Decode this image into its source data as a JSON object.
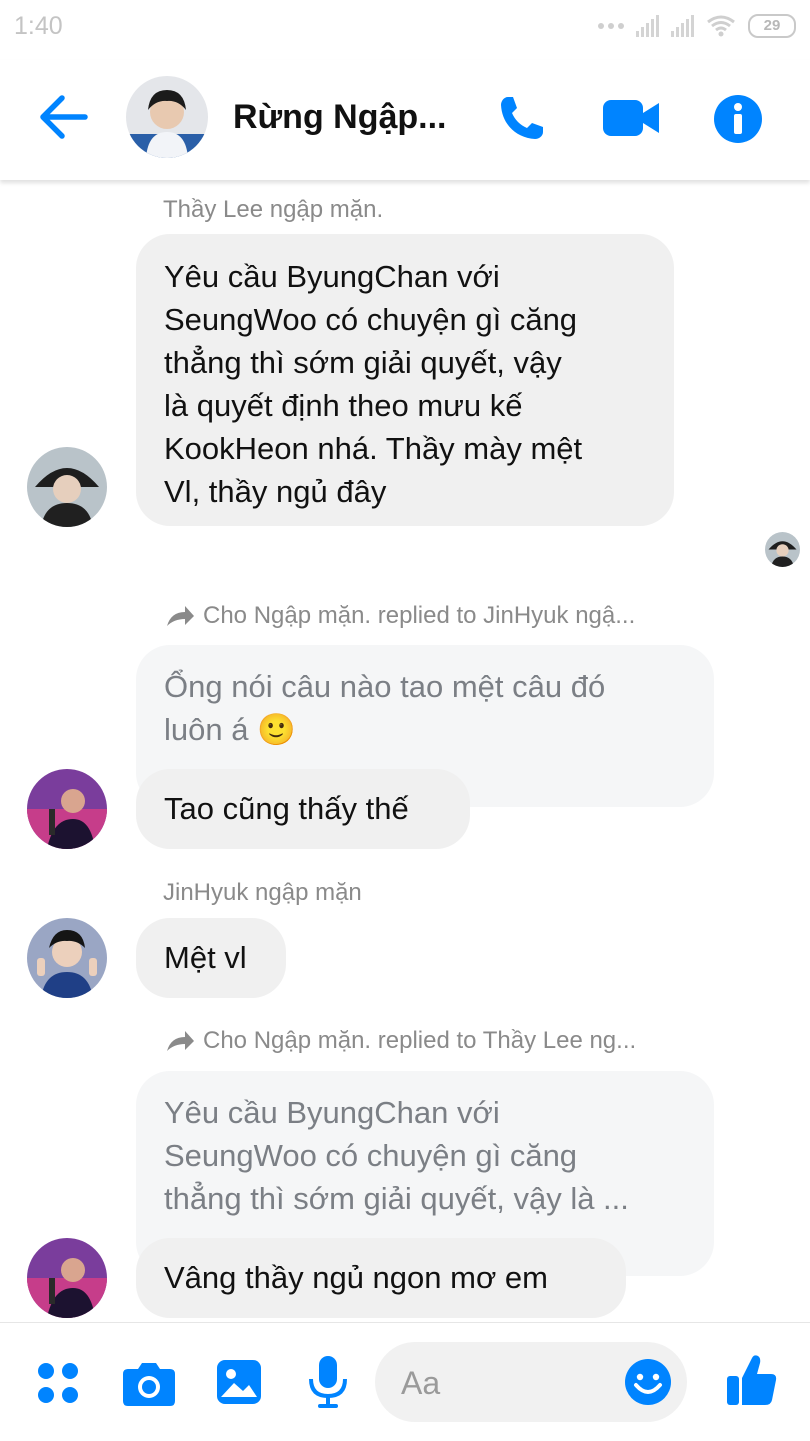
{
  "status_bar": {
    "time": "1:40",
    "battery": "29"
  },
  "header": {
    "title": "Rừng Ngập..."
  },
  "messages": {
    "m1": {
      "sender": "Thầy Lee ngập mặn.",
      "lines": [
        "Yêu cầu ByungChan với",
        "SeungWoo có chuyện gì căng",
        "thẳng thì sớm giải quyết, vậy",
        "là quyết định theo mưu kế",
        "KookHeon nhá. Thầy mày mệt",
        "Vl, thầy ngủ đây"
      ]
    },
    "m2": {
      "reply_context": "Cho Ngập mặn. replied to JinHyuk ngậ...",
      "quoted_lines": [
        "Ổng nói câu nào tao mệt câu đó",
        "luôn á 🙂"
      ],
      "reply_text": "Tao cũng thấy thế"
    },
    "m3": {
      "sender": "JinHyuk ngập mặn",
      "text": "Mệt vl"
    },
    "m4": {
      "reply_context": "Cho Ngập mặn. replied to Thầy Lee ng...",
      "quoted_lines": [
        "Yêu cầu ByungChan với",
        "SeungWoo có chuyện gì căng",
        "thẳng thì sớm giải quyết, vậy là ..."
      ],
      "reply_text": "Vâng thầy ngủ ngon mơ em"
    }
  },
  "composer": {
    "placeholder": "Aa"
  },
  "colors": {
    "accent": "#0084ff",
    "bubble": "#f0f0f0",
    "quoted_bubble": "#f5f6f7"
  }
}
